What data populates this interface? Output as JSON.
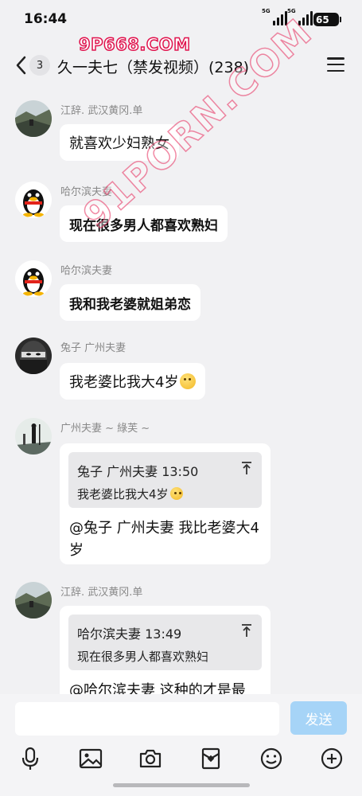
{
  "status_bar": {
    "time": "16:44",
    "signal1_label": "5G",
    "signal2_label": "5G",
    "battery": "65"
  },
  "watermarks": {
    "top": "9P668.COM",
    "diagonal": "91PORN.COM"
  },
  "nav": {
    "unread_count": "3",
    "title": "久一夫七（禁发视频）(238)"
  },
  "messages": [
    {
      "sender": "江辞. 武汉黄冈.单",
      "text": "就喜欢少妇熟女",
      "avatar": "landscape-avatar"
    },
    {
      "sender": "哈尔滨夫妻",
      "text": "现在很多男人都喜欢熟妇",
      "avatar": "penguin-avatar"
    },
    {
      "sender": "哈尔滨夫妻",
      "text": "我和我老婆就姐弟恋",
      "avatar": "penguin-avatar"
    },
    {
      "sender": "兔子 广州夫妻",
      "text": "我老婆比我大4岁",
      "emoji": "thinking-emoji",
      "avatar": "ninja-avatar"
    },
    {
      "sender": "广州夫妻 ~ 綠芙 ~",
      "avatar": "silhouette-avatar",
      "quote": {
        "author": "兔子 广州夫妻",
        "time": "13:50",
        "text": "我老婆比我大4岁",
        "emoji": "thinking-emoji"
      },
      "text": "@兔子 广州夫妻 我比老婆大4岁"
    },
    {
      "sender": "江辞. 武汉黄冈.单",
      "avatar": "landscape-avatar",
      "quote": {
        "author": "哈尔滨夫妻",
        "time": "13:49",
        "text": "现在很多男人都喜欢熟妇"
      },
      "text": "@哈尔滨夫妻 这种的才是最"
    }
  ],
  "input": {
    "placeholder": "",
    "send_label": "发送"
  },
  "toolbar": [
    "microphone-icon",
    "image-icon",
    "camera-icon",
    "red-packet-icon",
    "emoji-icon",
    "plus-icon"
  ],
  "colors": {
    "background": "#f1f1f3",
    "send_button": "#a6d4f7",
    "watermark": "#e0134d"
  }
}
